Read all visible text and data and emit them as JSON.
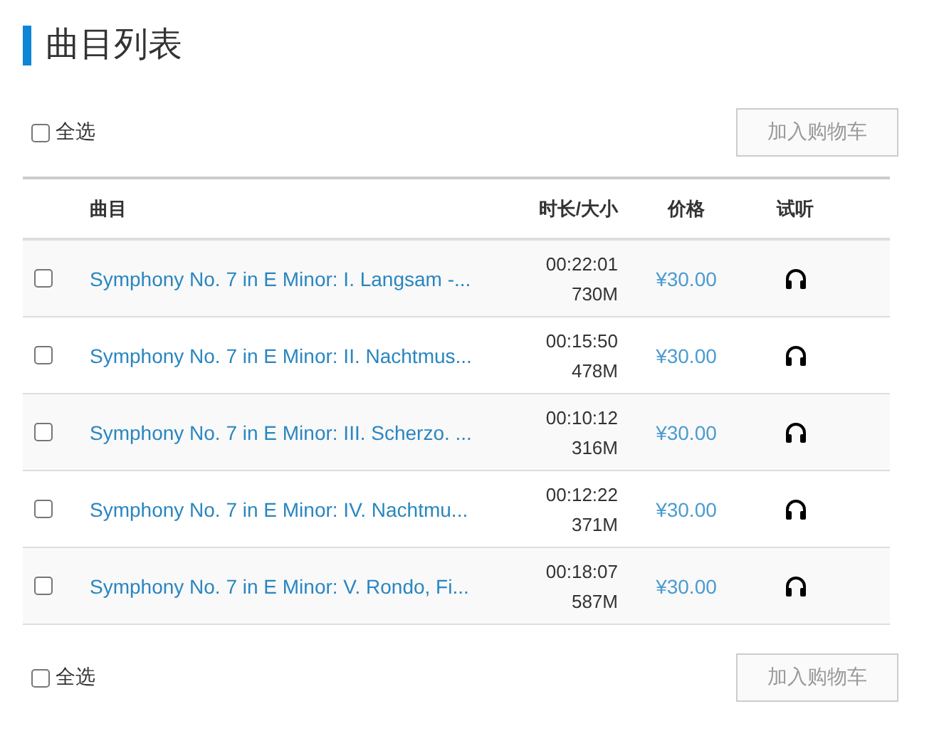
{
  "title": "曲目列表",
  "top_bar": {
    "select_all": {
      "label": "全选",
      "checked": false
    },
    "cart_button": {
      "label": "加入购物车",
      "disabled": true
    }
  },
  "table": {
    "columns": [
      "曲目",
      "时长/大小",
      "价格",
      "试听"
    ],
    "rows": [
      {
        "checked": false,
        "title": "Symphony No. 7 in E Minor: I. Langsam -...",
        "duration": "00:22:01",
        "size": "730M",
        "price": "¥30.00"
      },
      {
        "checked": false,
        "title": "Symphony No. 7 in E Minor: II. Nachtmus...",
        "duration": "00:15:50",
        "size": "478M",
        "price": "¥30.00"
      },
      {
        "checked": false,
        "title": "Symphony No. 7 in E Minor: III. Scherzo. ...",
        "duration": "00:10:12",
        "size": "316M",
        "price": "¥30.00"
      },
      {
        "checked": false,
        "title": "Symphony No. 7 in E Minor: IV. Nachtmu...",
        "duration": "00:12:22",
        "size": "371M",
        "price": "¥30.00"
      },
      {
        "checked": false,
        "title": "Symphony No. 7 in E Minor: V. Rondo, Fi...",
        "duration": "00:18:07",
        "size": "587M",
        "price": "¥30.00"
      }
    ]
  },
  "bottom_bar": {
    "select_all": {
      "label": "全选",
      "checked": false
    },
    "cart_button": {
      "label": "加入购物车",
      "disabled": true
    }
  }
}
